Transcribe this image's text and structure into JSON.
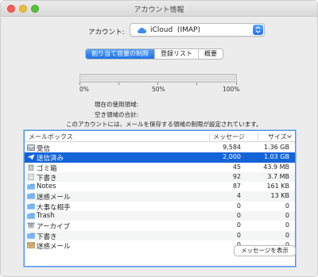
{
  "window": {
    "title": "アカウント情報"
  },
  "account": {
    "label": "アカウント:",
    "value": "iCloud  (IMAP)"
  },
  "tabs": [
    {
      "label": "割り当て容量の制限",
      "active": true
    },
    {
      "label": "登録リスト",
      "active": false
    },
    {
      "label": "概要",
      "active": false
    }
  ],
  "gauge": {
    "labels": [
      "0%",
      "50%",
      "100%"
    ],
    "used_fraction": 0
  },
  "info": {
    "current_usage_label": "現在の使用領域:",
    "total_space_label": "空き領域の合計:",
    "note": "このアカウントには、メールを保存する領域の制限が設定されています。"
  },
  "table": {
    "columns": {
      "mailbox": "メールボックス",
      "messages": "メッセージ",
      "size": "サイズ"
    },
    "rows": [
      {
        "name": "受信",
        "messages": "9,584",
        "size": "1.36 GB",
        "icon": "inbox-tray-icon"
      },
      {
        "name": "送信済み",
        "messages": "2,000",
        "size": "1.03 GB",
        "icon": "sent-paper-plane-icon",
        "selected": true
      },
      {
        "name": "ゴミ箱",
        "messages": "45",
        "size": "43.9 MB",
        "icon": "trash-icon"
      },
      {
        "name": "下書き",
        "messages": "92",
        "size": "3.7 MB",
        "icon": "draft-document-icon"
      },
      {
        "name": "Notes",
        "messages": "87",
        "size": "161 KB",
        "icon": "folder-icon"
      },
      {
        "name": "迷惑メール",
        "messages": "4",
        "size": "13 KB",
        "icon": "folder-icon"
      },
      {
        "name": "大事な相手",
        "messages": "0",
        "size": "0",
        "icon": "folder-icon"
      },
      {
        "name": "Trash",
        "messages": "0",
        "size": "0",
        "icon": "folder-icon"
      },
      {
        "name": "アーカイブ",
        "messages": "0",
        "size": "0",
        "icon": "archive-box-icon"
      },
      {
        "name": "下書き",
        "messages": "0",
        "size": "0",
        "icon": "folder-icon"
      },
      {
        "name": "迷惑メール",
        "messages": "0",
        "size": "0",
        "icon": "junk-mail-icon"
      }
    ]
  },
  "buttons": {
    "show_messages": "メッセージを表示"
  },
  "colors": {
    "accent": "#1464d8",
    "folder": "#5ea2ea",
    "close": "#fc5b57",
    "minimize": "#e5bf3c",
    "zoom": "#57c038"
  }
}
